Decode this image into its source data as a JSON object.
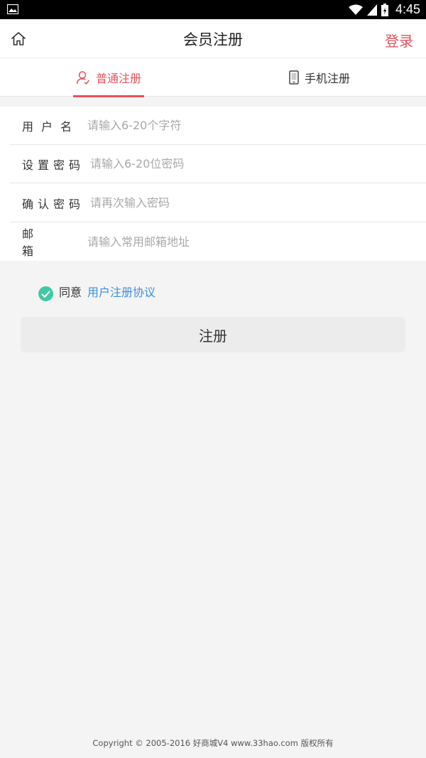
{
  "statusbar": {
    "time": "4:45"
  },
  "header": {
    "title": "会员注册",
    "login": "登录"
  },
  "tabs": [
    {
      "label": "普通注册",
      "active": true,
      "icon": "user-icon"
    },
    {
      "label": "手机注册",
      "active": false,
      "icon": "phone-icon"
    }
  ],
  "form": {
    "username": {
      "label": "用户名",
      "placeholder": "请输入6-20个字符"
    },
    "password": {
      "label": "设置密码",
      "placeholder": "请输入6-20位密码"
    },
    "confirm": {
      "label": "确认密码",
      "placeholder": "请再次输入密码"
    },
    "email": {
      "label": "邮箱",
      "placeholder": "请输入常用邮箱地址"
    }
  },
  "agreement": {
    "prefix": "同意",
    "link": "用户注册协议",
    "checked": true
  },
  "submit_label": "注册",
  "footer": "Copyright © 2005-2016 好商城V4 www.33hao.com 版权所有",
  "colors": {
    "accent": "#e8505b",
    "check": "#42c8a4",
    "link": "#3d8fe0"
  }
}
